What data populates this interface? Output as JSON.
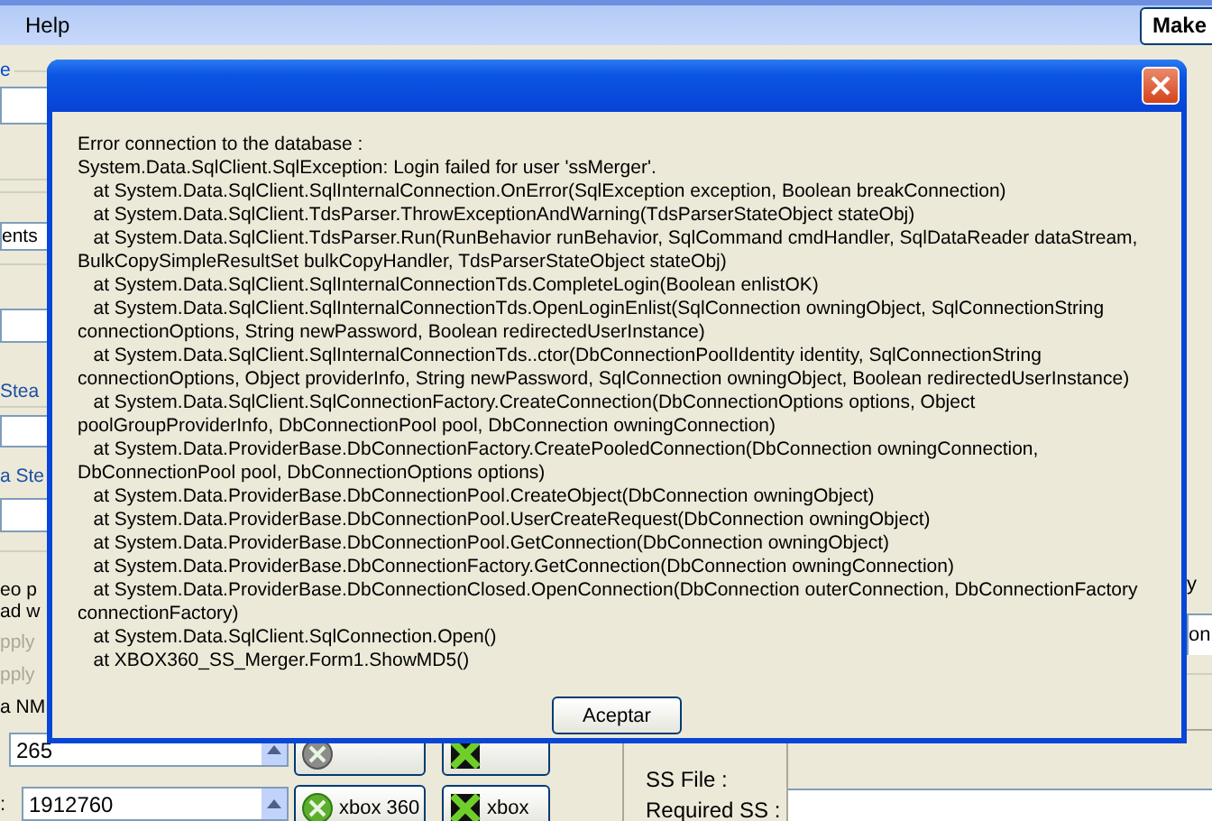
{
  "menu": [
    {
      "label": "Help"
    }
  ],
  "make_button": {
    "label": "Make"
  },
  "left_panel": {
    "group_caption": "e",
    "field_value": "ents",
    "labels": [
      "Stea",
      "a Ste"
    ],
    "description_lines": [
      "eo p",
      "ad w"
    ],
    "options": [
      {
        "label": "pply",
        "disabled": true
      },
      {
        "label": "pply",
        "disabled": true
      }
    ],
    "count_label": "a NM",
    "count_value": "265",
    "size_label": ":",
    "size_value": "1912760"
  },
  "action_buttons": [
    {
      "kind": "orb",
      "label": "xbox 360"
    },
    {
      "kind": "cross",
      "label": "xbox"
    }
  ],
  "info_panel": {
    "labels": [
      "SS File :",
      "Required SS :"
    ]
  },
  "right_panel": {
    "label": "y",
    "field_value": "on"
  },
  "dialog": {
    "message_lines": [
      "Error connection to the database :",
      "System.Data.SqlClient.SqlException: Login failed for user 'ssMerger'.",
      "   at System.Data.SqlClient.SqlInternalConnection.OnError(SqlException exception, Boolean breakConnection)",
      "   at System.Data.SqlClient.TdsParser.ThrowExceptionAndWarning(TdsParserStateObject stateObj)",
      "   at System.Data.SqlClient.TdsParser.Run(RunBehavior runBehavior, SqlCommand cmdHandler, SqlDataReader dataStream,",
      "BulkCopySimpleResultSet bulkCopyHandler, TdsParserStateObject stateObj)",
      "   at System.Data.SqlClient.SqlInternalConnectionTds.CompleteLogin(Boolean enlistOK)",
      "   at System.Data.SqlClient.SqlInternalConnectionTds.OpenLoginEnlist(SqlConnection owningObject, SqlConnectionString",
      "connectionOptions, String newPassword, Boolean redirectedUserInstance)",
      "   at System.Data.SqlClient.SqlInternalConnectionTds..ctor(DbConnectionPoolIdentity identity, SqlConnectionString",
      "connectionOptions, Object providerInfo, String newPassword, SqlConnection owningObject, Boolean redirectedUserInstance)",
      "   at System.Data.SqlClient.SqlConnectionFactory.CreateConnection(DbConnectionOptions options, Object",
      "poolGroupProviderInfo, DbConnectionPool pool, DbConnection owningConnection)",
      "   at System.Data.ProviderBase.DbConnectionFactory.CreatePooledConnection(DbConnection owningConnection,",
      "DbConnectionPool pool, DbConnectionOptions options)",
      "   at System.Data.ProviderBase.DbConnectionPool.CreateObject(DbConnection owningObject)",
      "   at System.Data.ProviderBase.DbConnectionPool.UserCreateRequest(DbConnection owningObject)",
      "   at System.Data.ProviderBase.DbConnectionPool.GetConnection(DbConnection owningObject)",
      "   at System.Data.ProviderBase.DbConnectionFactory.GetConnection(DbConnection owningConnection)",
      "   at System.Data.ProviderBase.DbConnectionClosed.OpenConnection(DbConnection outerConnection, DbConnectionFactory",
      "connectionFactory)",
      "   at System.Data.SqlClient.SqlConnection.Open()",
      "   at XBOX360_SS_Merger.Form1.ShowMD5()"
    ],
    "button": "Aceptar"
  }
}
